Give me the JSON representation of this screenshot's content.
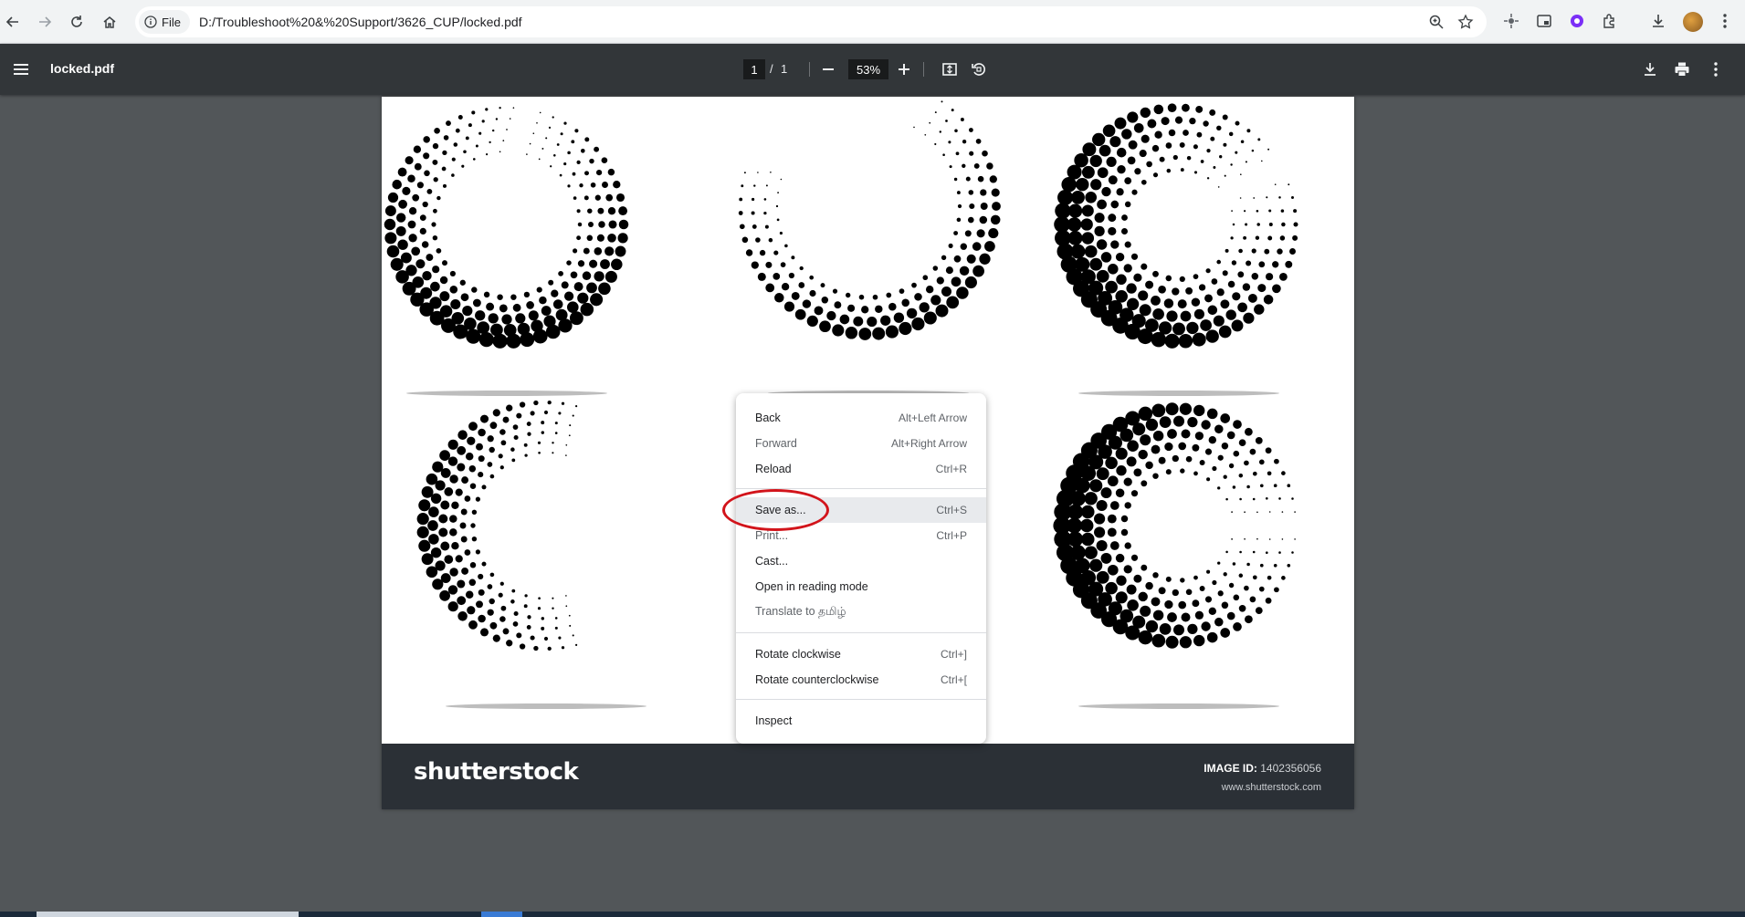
{
  "browser": {
    "site_chip_label": "File",
    "url": "D:/Troubleshoot%20&%20Support/3626_CUP/locked.pdf"
  },
  "pdf_toolbar": {
    "title": "locked.pdf",
    "current_page": "1",
    "page_separator": "/",
    "total_pages": "1",
    "zoom": "53%"
  },
  "document": {
    "brand": "shutterstock",
    "image_id_label": "IMAGE ID:",
    "image_id_value": "1402356056",
    "site": "www.shutterstock.com"
  },
  "context_menu": {
    "items": [
      {
        "label": "Back",
        "shortcut": "Alt+Left Arrow",
        "enabled": true
      },
      {
        "label": "Forward",
        "shortcut": "Alt+Right Arrow",
        "enabled": false
      },
      {
        "label": "Reload",
        "shortcut": "Ctrl+R",
        "enabled": true
      },
      {
        "label": "Save as...",
        "shortcut": "Ctrl+S",
        "enabled": true,
        "highlighted": true
      },
      {
        "label": "Print...",
        "shortcut": "Ctrl+P",
        "enabled": false
      },
      {
        "label": "Cast...",
        "shortcut": "",
        "enabled": true
      },
      {
        "label": "Open in reading mode",
        "shortcut": "",
        "enabled": true
      },
      {
        "label": "Translate to தமிழ்",
        "shortcut": "",
        "enabled": false
      },
      {
        "label": "Rotate clockwise",
        "shortcut": "Ctrl+]",
        "enabled": true
      },
      {
        "label": "Rotate counterclockwise",
        "shortcut": "Ctrl+[",
        "enabled": true
      },
      {
        "label": "Inspect",
        "shortcut": "",
        "enabled": true
      }
    ]
  },
  "colors": {
    "annotation_ellipse": "#d2141b",
    "pdf_toolbar_bg": "#323639",
    "viewer_bg": "#525659"
  }
}
